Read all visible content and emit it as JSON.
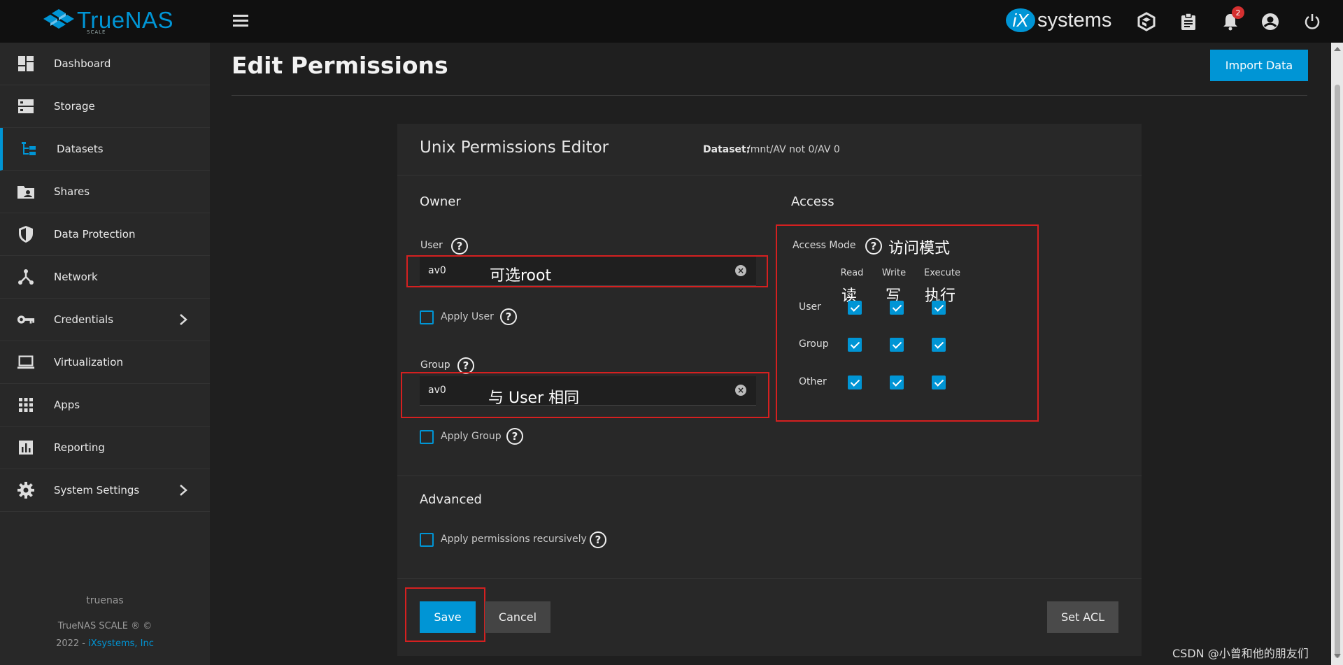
{
  "app": {
    "name": "TrueNAS",
    "edition": "SCALE",
    "vendor_i": "iX",
    "vendor_text": "systems",
    "notifications_count": "2",
    "brand_color": "#0095d5"
  },
  "sidebar": {
    "items": [
      {
        "label": "Dashboard",
        "icon": "dashboard-icon"
      },
      {
        "label": "Storage",
        "icon": "storage-icon"
      },
      {
        "label": "Datasets",
        "icon": "datasets-icon",
        "active": true
      },
      {
        "label": "Shares",
        "icon": "shares-icon"
      },
      {
        "label": "Data Protection",
        "icon": "shield-icon"
      },
      {
        "label": "Network",
        "icon": "network-icon"
      },
      {
        "label": "Credentials",
        "icon": "key-icon",
        "has_submenu": true
      },
      {
        "label": "Virtualization",
        "icon": "laptop-icon"
      },
      {
        "label": "Apps",
        "icon": "apps-grid-icon"
      },
      {
        "label": "Reporting",
        "icon": "reporting-icon"
      },
      {
        "label": "System Settings",
        "icon": "gear-icon",
        "has_submenu": true
      }
    ],
    "hostname": "truenas",
    "copyright_line1": "TrueNAS SCALE ® ©",
    "copyright_year": "2022 - ",
    "copyright_link": "iXsystems, Inc"
  },
  "page": {
    "title": "Edit Permissions",
    "import_button": "Import Data"
  },
  "editor": {
    "title": "Unix Permissions Editor",
    "dataset_label": "Dataset:",
    "dataset_value": "/mnt/AV not 0/AV 0",
    "owner": {
      "section_title": "Owner",
      "user_label": "User",
      "user_value": "av0",
      "apply_user_label": "Apply User",
      "group_label": "Group",
      "group_value": "av0",
      "apply_group_label": "Apply Group"
    },
    "access": {
      "section_title": "Access",
      "access_mode_label": "Access Mode",
      "columns": [
        "Read",
        "Write",
        "Execute"
      ],
      "rows": [
        {
          "label": "User",
          "read": true,
          "write": true,
          "execute": true
        },
        {
          "label": "Group",
          "read": true,
          "write": true,
          "execute": true
        },
        {
          "label": "Other",
          "read": true,
          "write": true,
          "execute": true
        }
      ]
    },
    "advanced": {
      "section_title": "Advanced",
      "recursive_label": "Apply permissions recursively"
    },
    "buttons": {
      "save": "Save",
      "cancel": "Cancel",
      "set_acl": "Set ACL"
    }
  },
  "annotations": {
    "user_note": "可选root",
    "group_note": "与 User 相同",
    "access_note": "访问模式",
    "read_note": "读",
    "write_note": "写",
    "execute_note": "执行"
  },
  "watermark": "CSDN @小曾和他的朋友们"
}
